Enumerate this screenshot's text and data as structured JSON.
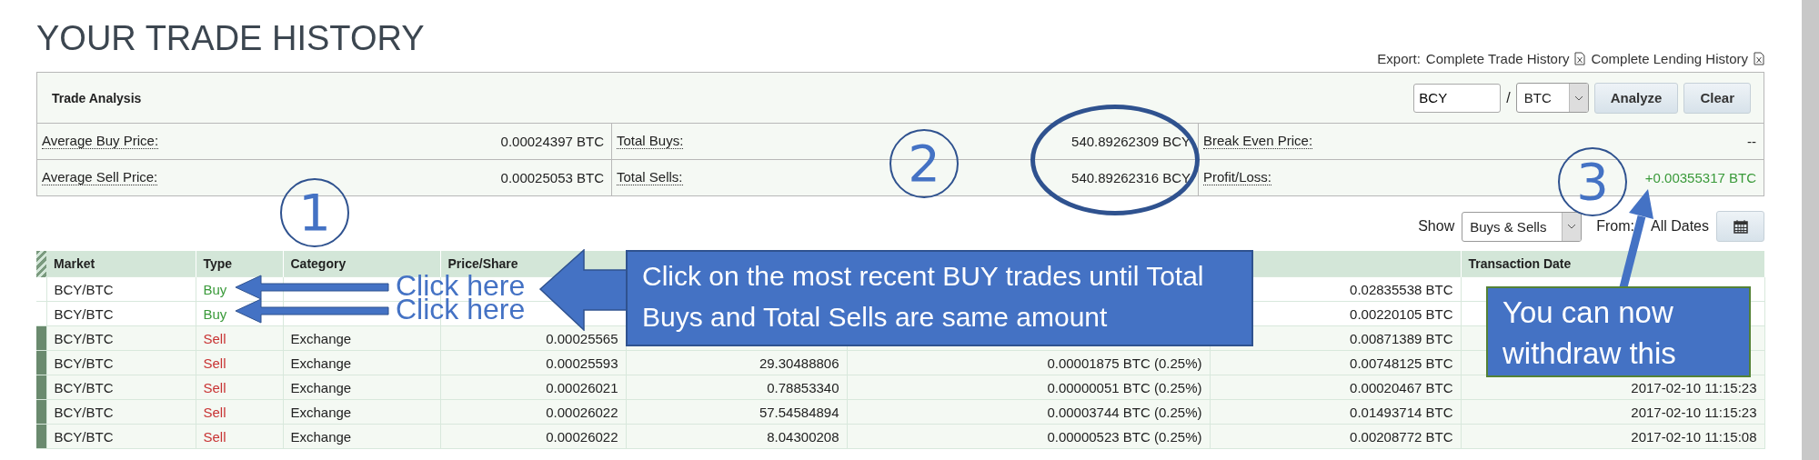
{
  "page_title": "YOUR TRADE HISTORY",
  "export": {
    "label": "Export:",
    "links": [
      "Complete Trade History",
      "Complete Lending History"
    ]
  },
  "trade_analysis": {
    "title": "Trade Analysis",
    "base_currency": "BCY",
    "separator": "/",
    "quote_currency": "BTC",
    "buttons": [
      "Analyze",
      "Clear"
    ],
    "rows": [
      [
        {
          "label": "Average Buy Price:",
          "value": "0.00024397 BTC"
        },
        {
          "label": "Total Buys:",
          "value": "540.89262309 BCY"
        },
        {
          "label": "Break Even Price:",
          "value": "--"
        }
      ],
      [
        {
          "label": "Average Sell Price:",
          "value": "0.00025053 BTC"
        },
        {
          "label": "Total Sells:",
          "value": "540.89262316 BCY"
        },
        {
          "label": "Profit/Loss:",
          "value": "+0.00355317 BTC",
          "kind": "gain"
        }
      ]
    ]
  },
  "filters": {
    "show_label": "Show",
    "show_value": "Buys & Sells",
    "from_label": "From:",
    "range_value": "All Dates"
  },
  "table": {
    "columns": [
      {
        "label": "Market"
      },
      {
        "label": "Type"
      },
      {
        "label": "Category"
      },
      {
        "label": "Price/Share"
      },
      {},
      {},
      {},
      {
        "label": "Transaction Date"
      }
    ],
    "rows": [
      {
        "market": "BCY/BTC",
        "type": "Buy",
        "kind": "buy",
        "total": "0.02835538 BTC",
        "selected": false
      },
      {
        "market": "BCY/BTC",
        "type": "Buy",
        "kind": "buy",
        "total": "0.00220105 BTC",
        "selected": false
      },
      {
        "market": "BCY/BTC",
        "type": "Sell",
        "kind": "sell",
        "category": "Exchange",
        "price": "0.00025565",
        "total": "0.00871389 BTC",
        "selected": true
      },
      {
        "market": "BCY/BTC",
        "type": "Sell",
        "kind": "sell",
        "category": "Exchange",
        "price": "0.00025593",
        "amount": "29.30488806",
        "fee": "0.00001875 BTC (0.25%)",
        "total": "0.00748125 BTC",
        "selected": true
      },
      {
        "market": "BCY/BTC",
        "type": "Sell",
        "kind": "sell",
        "category": "Exchange",
        "price": "0.00026021",
        "amount": "0.78853340",
        "fee": "0.00000051 BTC (0.25%)",
        "total": "0.00020467 BTC",
        "date": "2017-02-10 11:15:23",
        "selected": true
      },
      {
        "market": "BCY/BTC",
        "type": "Sell",
        "kind": "sell",
        "category": "Exchange",
        "price": "0.00026022",
        "amount": "57.54584894",
        "fee": "0.00003744 BTC (0.25%)",
        "total": "0.01493714 BTC",
        "date": "2017-02-10 11:15:23",
        "selected": true
      },
      {
        "market": "BCY/BTC",
        "type": "Sell",
        "kind": "sell",
        "category": "Exchange",
        "price": "0.00026022",
        "amount": "8.04300208",
        "fee": "0.00000523 BTC (0.25%)",
        "total": "0.00208772 BTC",
        "date": "2017-02-10 11:15:08",
        "selected": true
      }
    ]
  },
  "annotations": {
    "markers": [
      "1",
      "2",
      "3"
    ],
    "click_hints": [
      "Click here",
      "Click here"
    ],
    "callouts": [
      "Click on the most recent BUY trades until Total Buys and Total Sells are same amount",
      "You can now withdraw this"
    ]
  }
}
